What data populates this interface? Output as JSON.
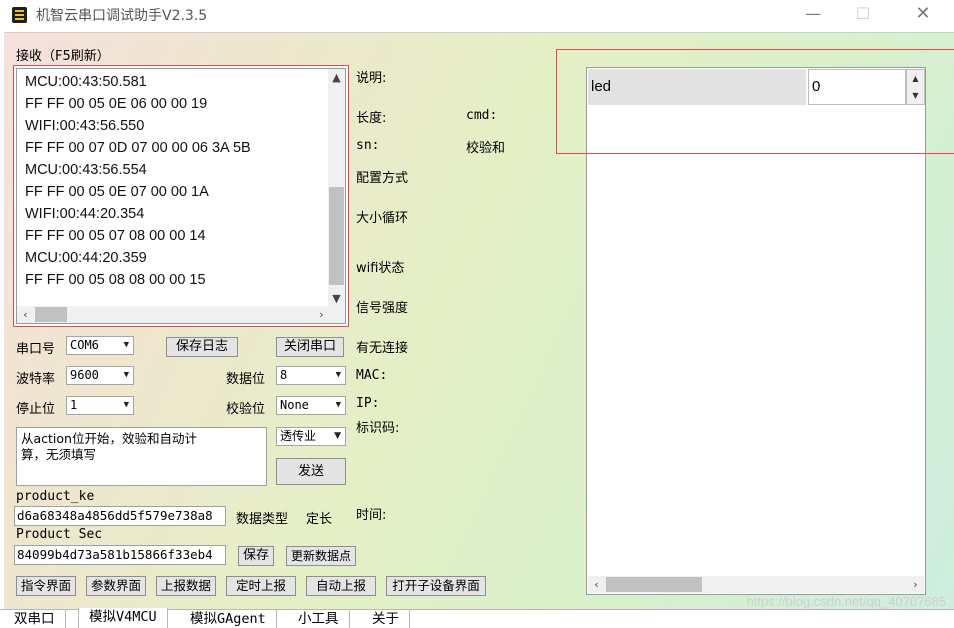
{
  "window": {
    "title": "机智云串口调试助手V2.3.5",
    "controls": {
      "minimize": "—",
      "maximize": "☐",
      "close": "✕"
    }
  },
  "receive": {
    "title": "接收（F5刷新）",
    "lines": [
      "MCU:00:43:50.581",
      "FF FF 00 05 0E 06 00 00 19",
      "WIFI:00:43:56.550",
      "FF FF 00 07 0D 07 00 00 06 3A 5B",
      "MCU:00:43:56.554",
      "FF FF 00 05 0E 07 00 00 1A",
      "WIFI:00:44:20.354",
      "FF FF 00 05 07 08 00 00 14",
      "MCU:00:44:20.359",
      "FF FF 00 05 08 08 00 00 15"
    ]
  },
  "serial": {
    "port_label": "串口号",
    "port_value": "COM6",
    "save_log_button": "保存日志",
    "close_port_button": "关闭串口",
    "baud_label": "波特率",
    "baud_value": "9600",
    "databits_label": "数据位",
    "databits_value": "8",
    "stopbits_label": "停止位",
    "stopbits_value": "1",
    "parity_label": "校验位",
    "parity_value": "None"
  },
  "send": {
    "text": "从action位开始，效验和自动计\n算，无须填写",
    "mode_value": "透传业",
    "send_button": "发送"
  },
  "product": {
    "key_label": "product_ke",
    "key_value": "d6a68348a4856dd5f579e738a8",
    "data_type_label": "数据类型",
    "data_type_value": "定长",
    "secret_label": "Product Sec",
    "secret_value": "84099b4d73a581b15866f33eb4",
    "save_button": "保存",
    "update_button": "更新数据点"
  },
  "bottom_buttons": [
    "指令界面",
    "参数界面",
    "上报数据",
    "定时上报",
    "自动上报",
    "打开子设备界面"
  ],
  "info": {
    "desc_label": "说明:",
    "length_label": "长度:",
    "cmd_label": "cmd:",
    "sn_label": "sn:",
    "checksum_label": "校验和",
    "config_label": "配置方式",
    "loop_label": "大小循环",
    "wifi_status_label": "wifi状态",
    "signal_label": "信号强度",
    "connection_label": "有无连接",
    "mac_label": "MAC:",
    "ip_label": "IP:",
    "id_label": "标识码:",
    "time_label": "时间:"
  },
  "datapoints": [
    {
      "name": "led",
      "value": "0"
    }
  ],
  "tabs": [
    "双串口",
    "模拟V4MCU",
    "模拟GAgent",
    "小工具",
    "关于"
  ],
  "active_tab": "模拟V4MCU",
  "watermark": "https://blog.csdn.net/qq_40707685",
  "colors": {
    "highlight_frame": "#e14b4b"
  }
}
